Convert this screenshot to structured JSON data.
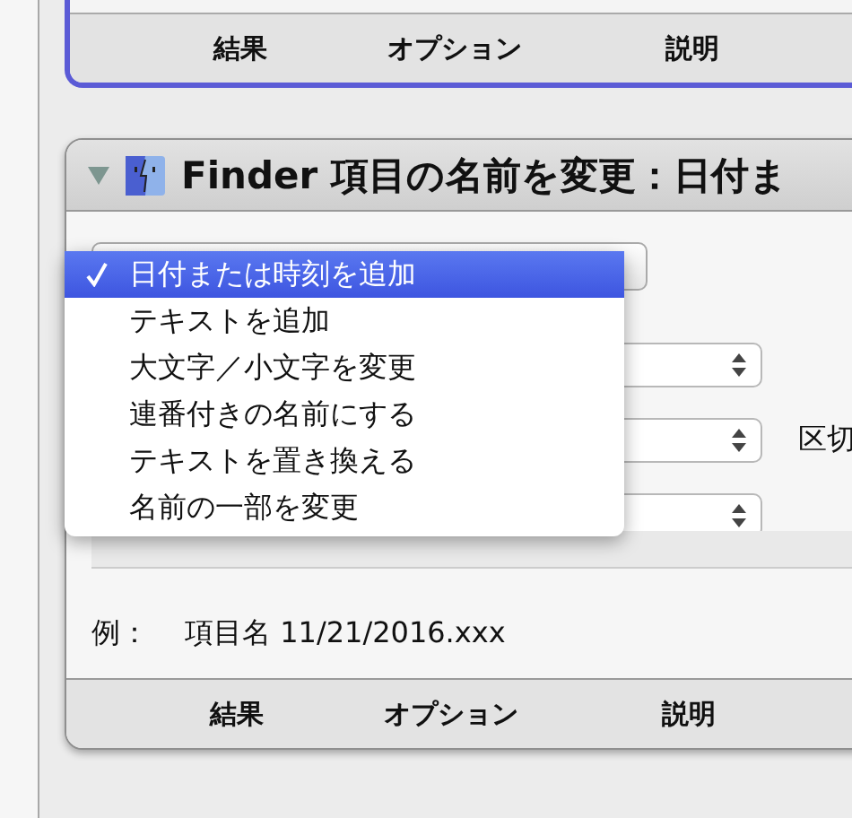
{
  "top_action": {
    "tabs": [
      {
        "label": "結果"
      },
      {
        "label": "オプション"
      },
      {
        "label": "説明"
      }
    ]
  },
  "action": {
    "expanded": true,
    "title": "Finder 項目の名前を変更：日付ま",
    "popup_menu": {
      "items": [
        {
          "label": "日付または時刻を追加",
          "selected": true
        },
        {
          "label": "テキストを追加",
          "selected": false
        },
        {
          "label": "大文字／小文字を変更",
          "selected": false
        },
        {
          "label": "連番付きの名前にする",
          "selected": false
        },
        {
          "label": "テキストを置き換える",
          "selected": false
        },
        {
          "label": "名前の一部を変更",
          "selected": false
        }
      ]
    },
    "separator_label": "区切",
    "example": {
      "label": "例：",
      "value": "項目名 11/21/2016.xxx"
    },
    "tabs": [
      {
        "label": "結果"
      },
      {
        "label": "オプション"
      },
      {
        "label": "説明"
      }
    ]
  }
}
